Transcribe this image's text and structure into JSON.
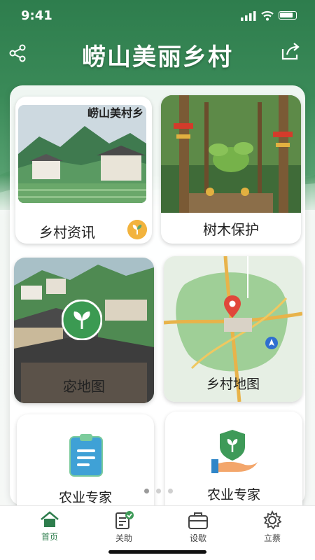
{
  "status_bar": {
    "time": "9:41"
  },
  "header": {
    "title": "崂山美丽乡村"
  },
  "cards": [
    {
      "id": "village-news",
      "label": "乡村资讯",
      "image_caption": "崂山美村乡"
    },
    {
      "id": "tree-protection",
      "label": "树木保护"
    },
    {
      "id": "homestead-map",
      "label": "�od地图"
    },
    {
      "id": "village-map",
      "label": "乡村地图"
    },
    {
      "id": "expert-1",
      "label": "农业专家"
    },
    {
      "id": "expert-2",
      "label": "农业专家"
    }
  ],
  "pagination": {
    "total": 3,
    "active": 0
  },
  "tabbar": [
    {
      "label": "首页",
      "icon": "home-icon",
      "active": true
    },
    {
      "label": "关助",
      "icon": "clipboard-check-icon",
      "active": false
    },
    {
      "label": "设歇",
      "icon": "briefcase-icon",
      "active": false
    },
    {
      "label": "立蔡",
      "icon": "gear-icon",
      "active": false
    }
  ],
  "colors": {
    "brand_green": "#2e7d4d",
    "badge_orange": "#f2b33d",
    "map_pin": "#e0473a",
    "expert_blue": "#2f86c8"
  }
}
